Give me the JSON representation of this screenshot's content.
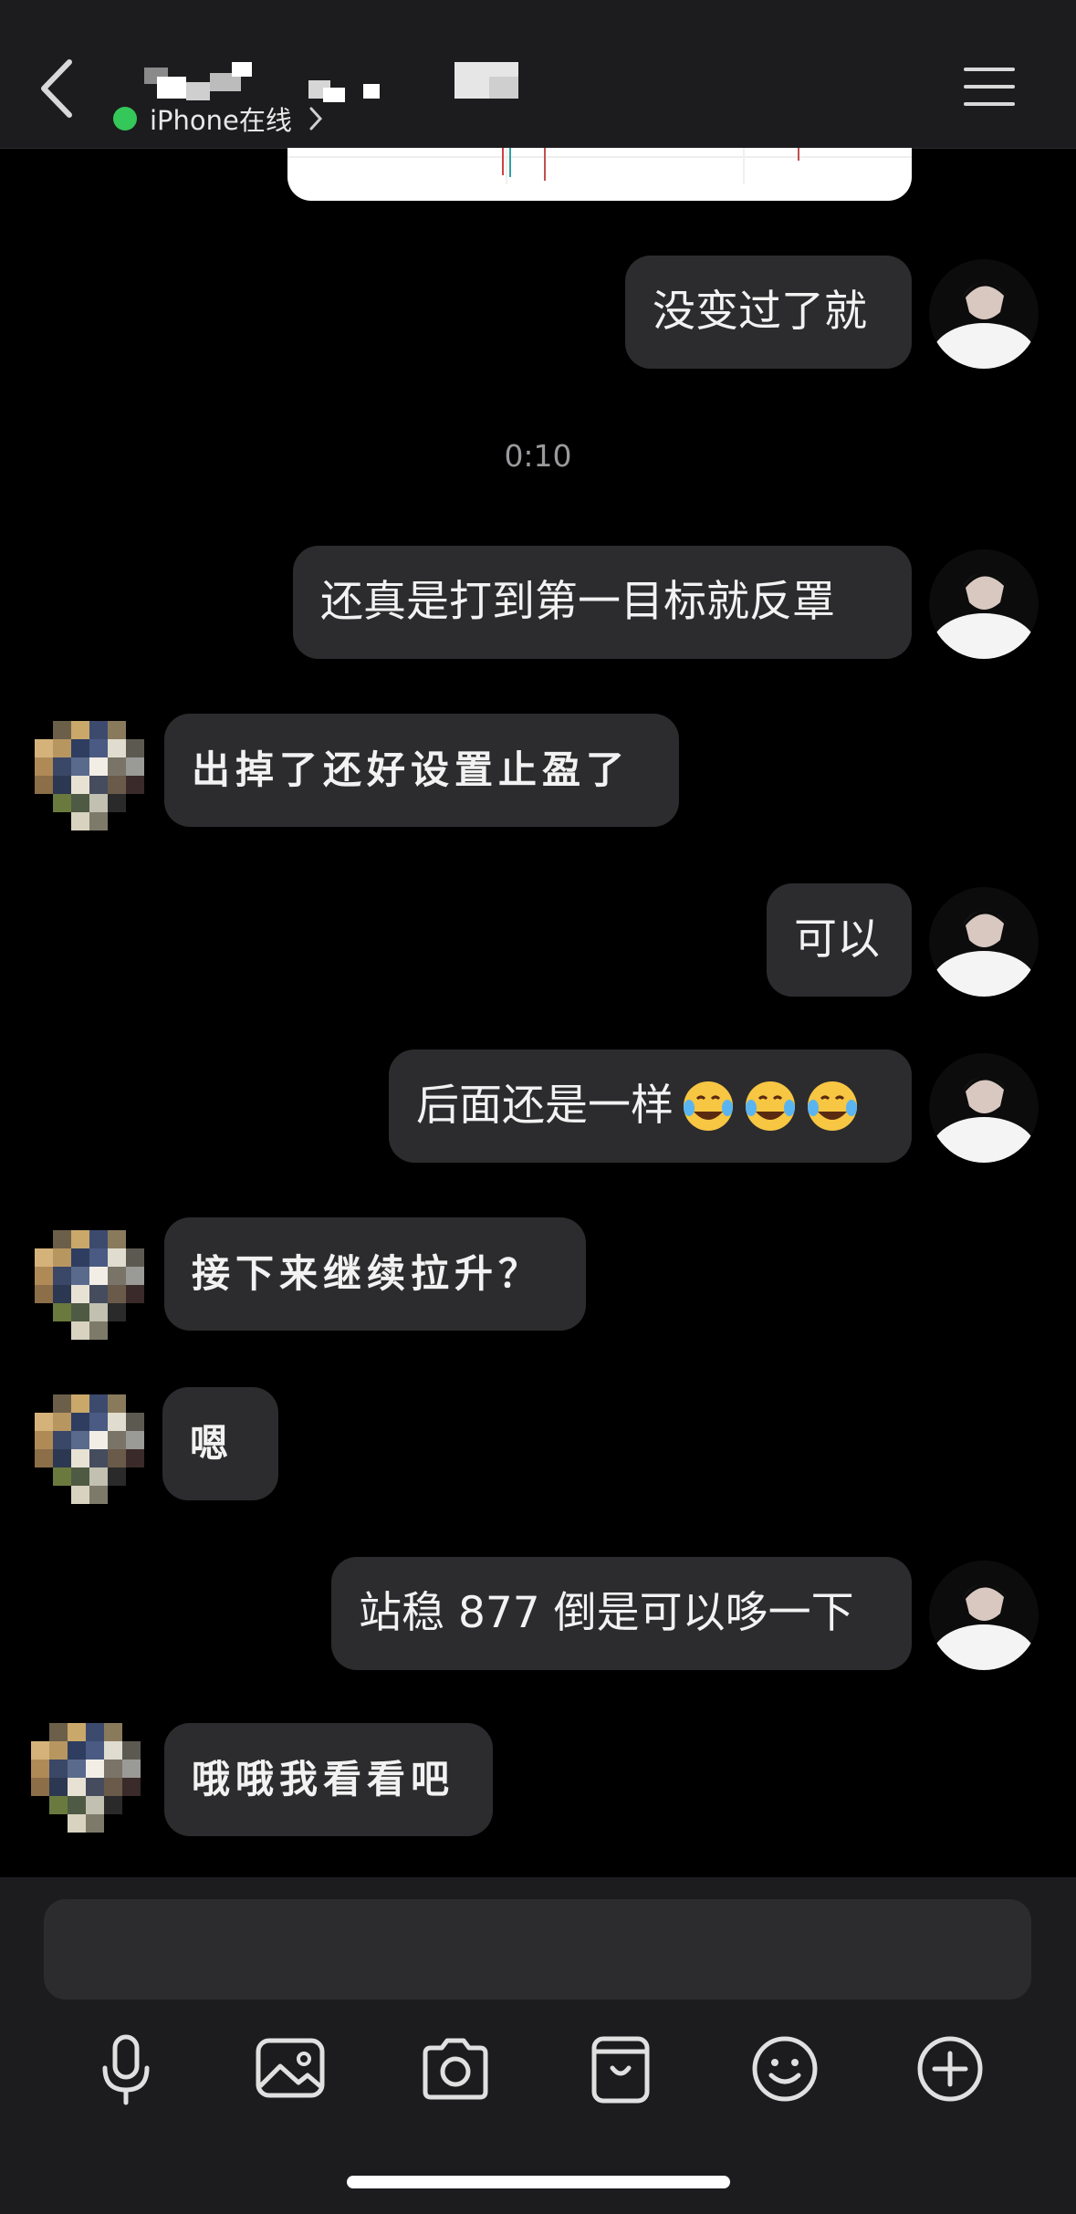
{
  "header": {
    "status_text": "iPhone在线",
    "status_color": "#34c759",
    "back_icon": "chevron-left-icon",
    "menu_icon": "hamburger-menu-icon"
  },
  "messages": {
    "m1": "没变过了就",
    "time": "0:10",
    "m2": "还真是打到第一目标就反罩",
    "m3": "出掉了还好设置止盈了",
    "m4": "可以",
    "m5": "后面还是一样",
    "m6": "接下来继续拉升？",
    "m7": "嗯",
    "m8": "站稳 877 倒是可以哆一下",
    "m9": "哦哦我看看吧"
  },
  "toolbar": {
    "icons": [
      "microphone-icon",
      "image-icon",
      "camera-icon",
      "wallet-icon",
      "emoji-icon",
      "plus-icon"
    ]
  },
  "colors": {
    "background": "#000000",
    "bubble": "#2c2c2e",
    "panel": "#1c1c1e"
  }
}
